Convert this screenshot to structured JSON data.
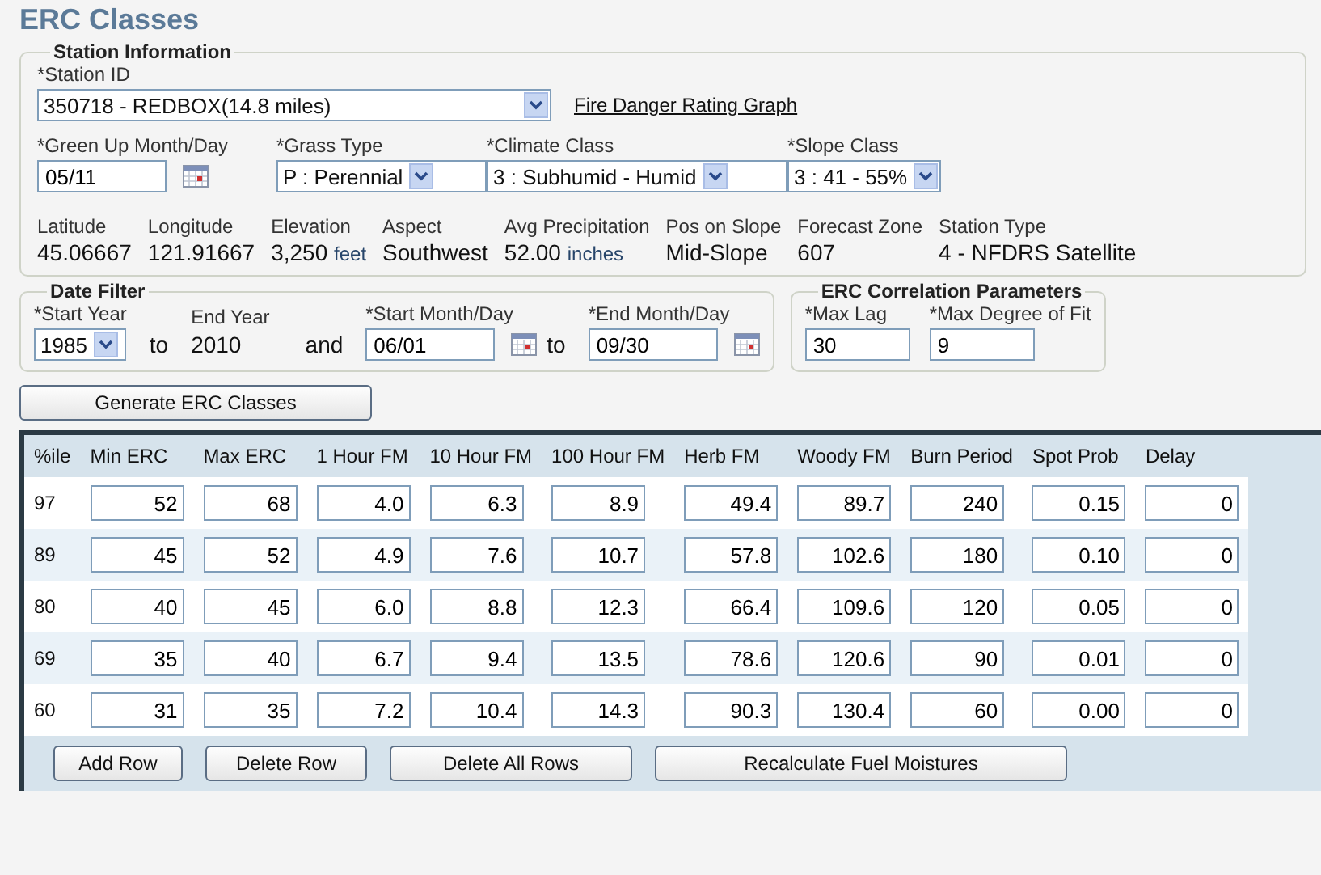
{
  "title": "ERC Classes",
  "station_info": {
    "legend": "Station Information",
    "station_label": "*Station ID",
    "station_value": "350718 - REDBOX(14.8 miles)",
    "graph_link": "Fire Danger Rating Graph",
    "fields": [
      {
        "label": "*Green Up Month/Day",
        "value": "05/11",
        "kind": "date"
      },
      {
        "label": "*Grass Type",
        "value": "P : Perennial",
        "kind": "select"
      },
      {
        "label": "*Climate Class",
        "value": "3 : Subhumid - Humid",
        "kind": "select"
      },
      {
        "label": "*Slope Class",
        "value": "3 : 41 - 55%",
        "kind": "select"
      }
    ],
    "details": [
      {
        "label": "Latitude",
        "value": "45.06667"
      },
      {
        "label": "Longitude",
        "value": "121.91667"
      },
      {
        "label": "Elevation",
        "value": "3,250",
        "unit": "feet"
      },
      {
        "label": "Aspect",
        "value": "Southwest"
      },
      {
        "label": "Avg Precipitation",
        "value": "52.00",
        "unit": "inches"
      },
      {
        "label": "Pos on Slope",
        "value": "Mid-Slope"
      },
      {
        "label": "Forecast Zone",
        "value": "607"
      },
      {
        "label": "Station Type",
        "value": "4 - NFDRS Satellite"
      }
    ]
  },
  "date_filter": {
    "legend": "Date Filter",
    "start_year_label": "*Start Year",
    "start_year": "1985",
    "to_1": "to",
    "end_year_label": "End Year",
    "end_year": "2010",
    "and": "and",
    "start_md_label": "*Start Month/Day",
    "start_md": "06/01",
    "to_2": "to",
    "end_md_label": "*End Month/Day",
    "end_md": "09/30"
  },
  "erc_params": {
    "legend": "ERC Correlation Parameters",
    "fields": [
      {
        "label": "*Max Lag",
        "value": "30"
      },
      {
        "label": "*Max Degree of Fit",
        "value": "9"
      }
    ]
  },
  "generate_button": "Generate ERC Classes",
  "table": {
    "columns": [
      "%ile",
      "Min ERC",
      "Max ERC",
      "1 Hour FM",
      "10 Hour FM",
      "100 Hour FM",
      "Herb FM",
      "Woody FM",
      "Burn Period",
      "Spot Prob",
      "Delay"
    ],
    "rows": [
      [
        "97",
        "52",
        "68",
        "4.0",
        "6.3",
        "8.9",
        "49.4",
        "89.7",
        "240",
        "0.15",
        "0"
      ],
      [
        "89",
        "45",
        "52",
        "4.9",
        "7.6",
        "10.7",
        "57.8",
        "102.6",
        "180",
        "0.10",
        "0"
      ],
      [
        "80",
        "40",
        "45",
        "6.0",
        "8.8",
        "12.3",
        "66.4",
        "109.6",
        "120",
        "0.05",
        "0"
      ],
      [
        "69",
        "35",
        "40",
        "6.7",
        "9.4",
        "13.5",
        "78.6",
        "120.6",
        "90",
        "0.01",
        "0"
      ],
      [
        "60",
        "31",
        "35",
        "7.2",
        "10.4",
        "14.3",
        "90.3",
        "130.4",
        "60",
        "0.00",
        "0"
      ]
    ]
  },
  "table_buttons": [
    "Add Row",
    "Delete Row",
    "Delete All Rows",
    "Recalculate Fuel Moistures"
  ]
}
